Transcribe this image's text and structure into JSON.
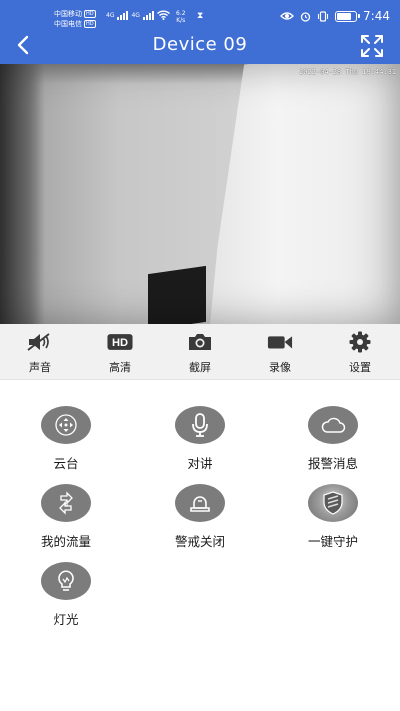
{
  "status_bar": {
    "carrier1": "中国移动",
    "carrier2": "中国电信",
    "hd_badge": "HD",
    "net_type1": "4G",
    "net_type2": "4G",
    "speed_value": "6.2",
    "speed_unit": "K/s",
    "time": "7:44"
  },
  "nav": {
    "title": "Device 09"
  },
  "video": {
    "timestamp": "2022-04-28 Thu 19:44:31"
  },
  "toolbar": {
    "items": [
      {
        "label": "声音",
        "icon": "speaker-muted-icon"
      },
      {
        "label": "高清",
        "icon": "hd-icon",
        "icon_text": "HD"
      },
      {
        "label": "截屏",
        "icon": "camera-icon"
      },
      {
        "label": "录像",
        "icon": "video-camera-icon"
      },
      {
        "label": "设置",
        "icon": "gear-icon"
      }
    ]
  },
  "features": {
    "items": [
      {
        "label": "云台",
        "icon": "ptz-arrows-icon"
      },
      {
        "label": "对讲",
        "icon": "microphone-icon"
      },
      {
        "label": "报警消息",
        "icon": "cloud-icon"
      },
      {
        "label": "我的流量",
        "icon": "data-refresh-icon"
      },
      {
        "label": "警戒关闭",
        "icon": "siren-icon"
      },
      {
        "label": "一键守护",
        "icon": "shield-icon"
      },
      {
        "label": "灯光",
        "icon": "light-bulb-icon"
      }
    ]
  },
  "colors": {
    "header": "#3f6ed4",
    "toolbar_bg": "#f1f1f1",
    "feature_circle": "#7c7c7c",
    "icon_dark": "#3a3a3a"
  }
}
